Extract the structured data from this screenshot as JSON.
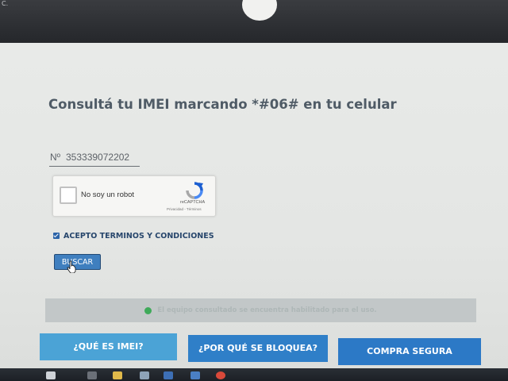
{
  "corner_text": "C.",
  "page": {
    "title": "Consultá tu IMEI marcando *#06# en tu celular",
    "imei_prefix": "Nº",
    "imei_value": "353339072202"
  },
  "captcha": {
    "label": "No soy un robot",
    "brand": "reCAPTCHA",
    "links": "Privacidad - Términos"
  },
  "terms": {
    "checked": true,
    "label": "ACEPTO TERMINOS Y CONDICIONES"
  },
  "search_button": "BUSCAR",
  "status": {
    "text": "El equipo consultado se encuentra habilitado para el uso.",
    "color": "#3faa5a"
  },
  "bottom_buttons": {
    "imei": "¿QUÉ ES IMEI?",
    "bloqueo": "¿POR QUÉ SE BLOQUEA?",
    "compra": "COMPRA SEGURA"
  },
  "colors": {
    "accent": "#2f7fc8",
    "title": "#4f5b66"
  },
  "taskbar": {
    "icons": [
      "windows-icon",
      "search-icon",
      "task-view-icon",
      "file-explorer-icon",
      "store-icon",
      "app-icon",
      "chrome-icon",
      "edge-icon"
    ]
  }
}
